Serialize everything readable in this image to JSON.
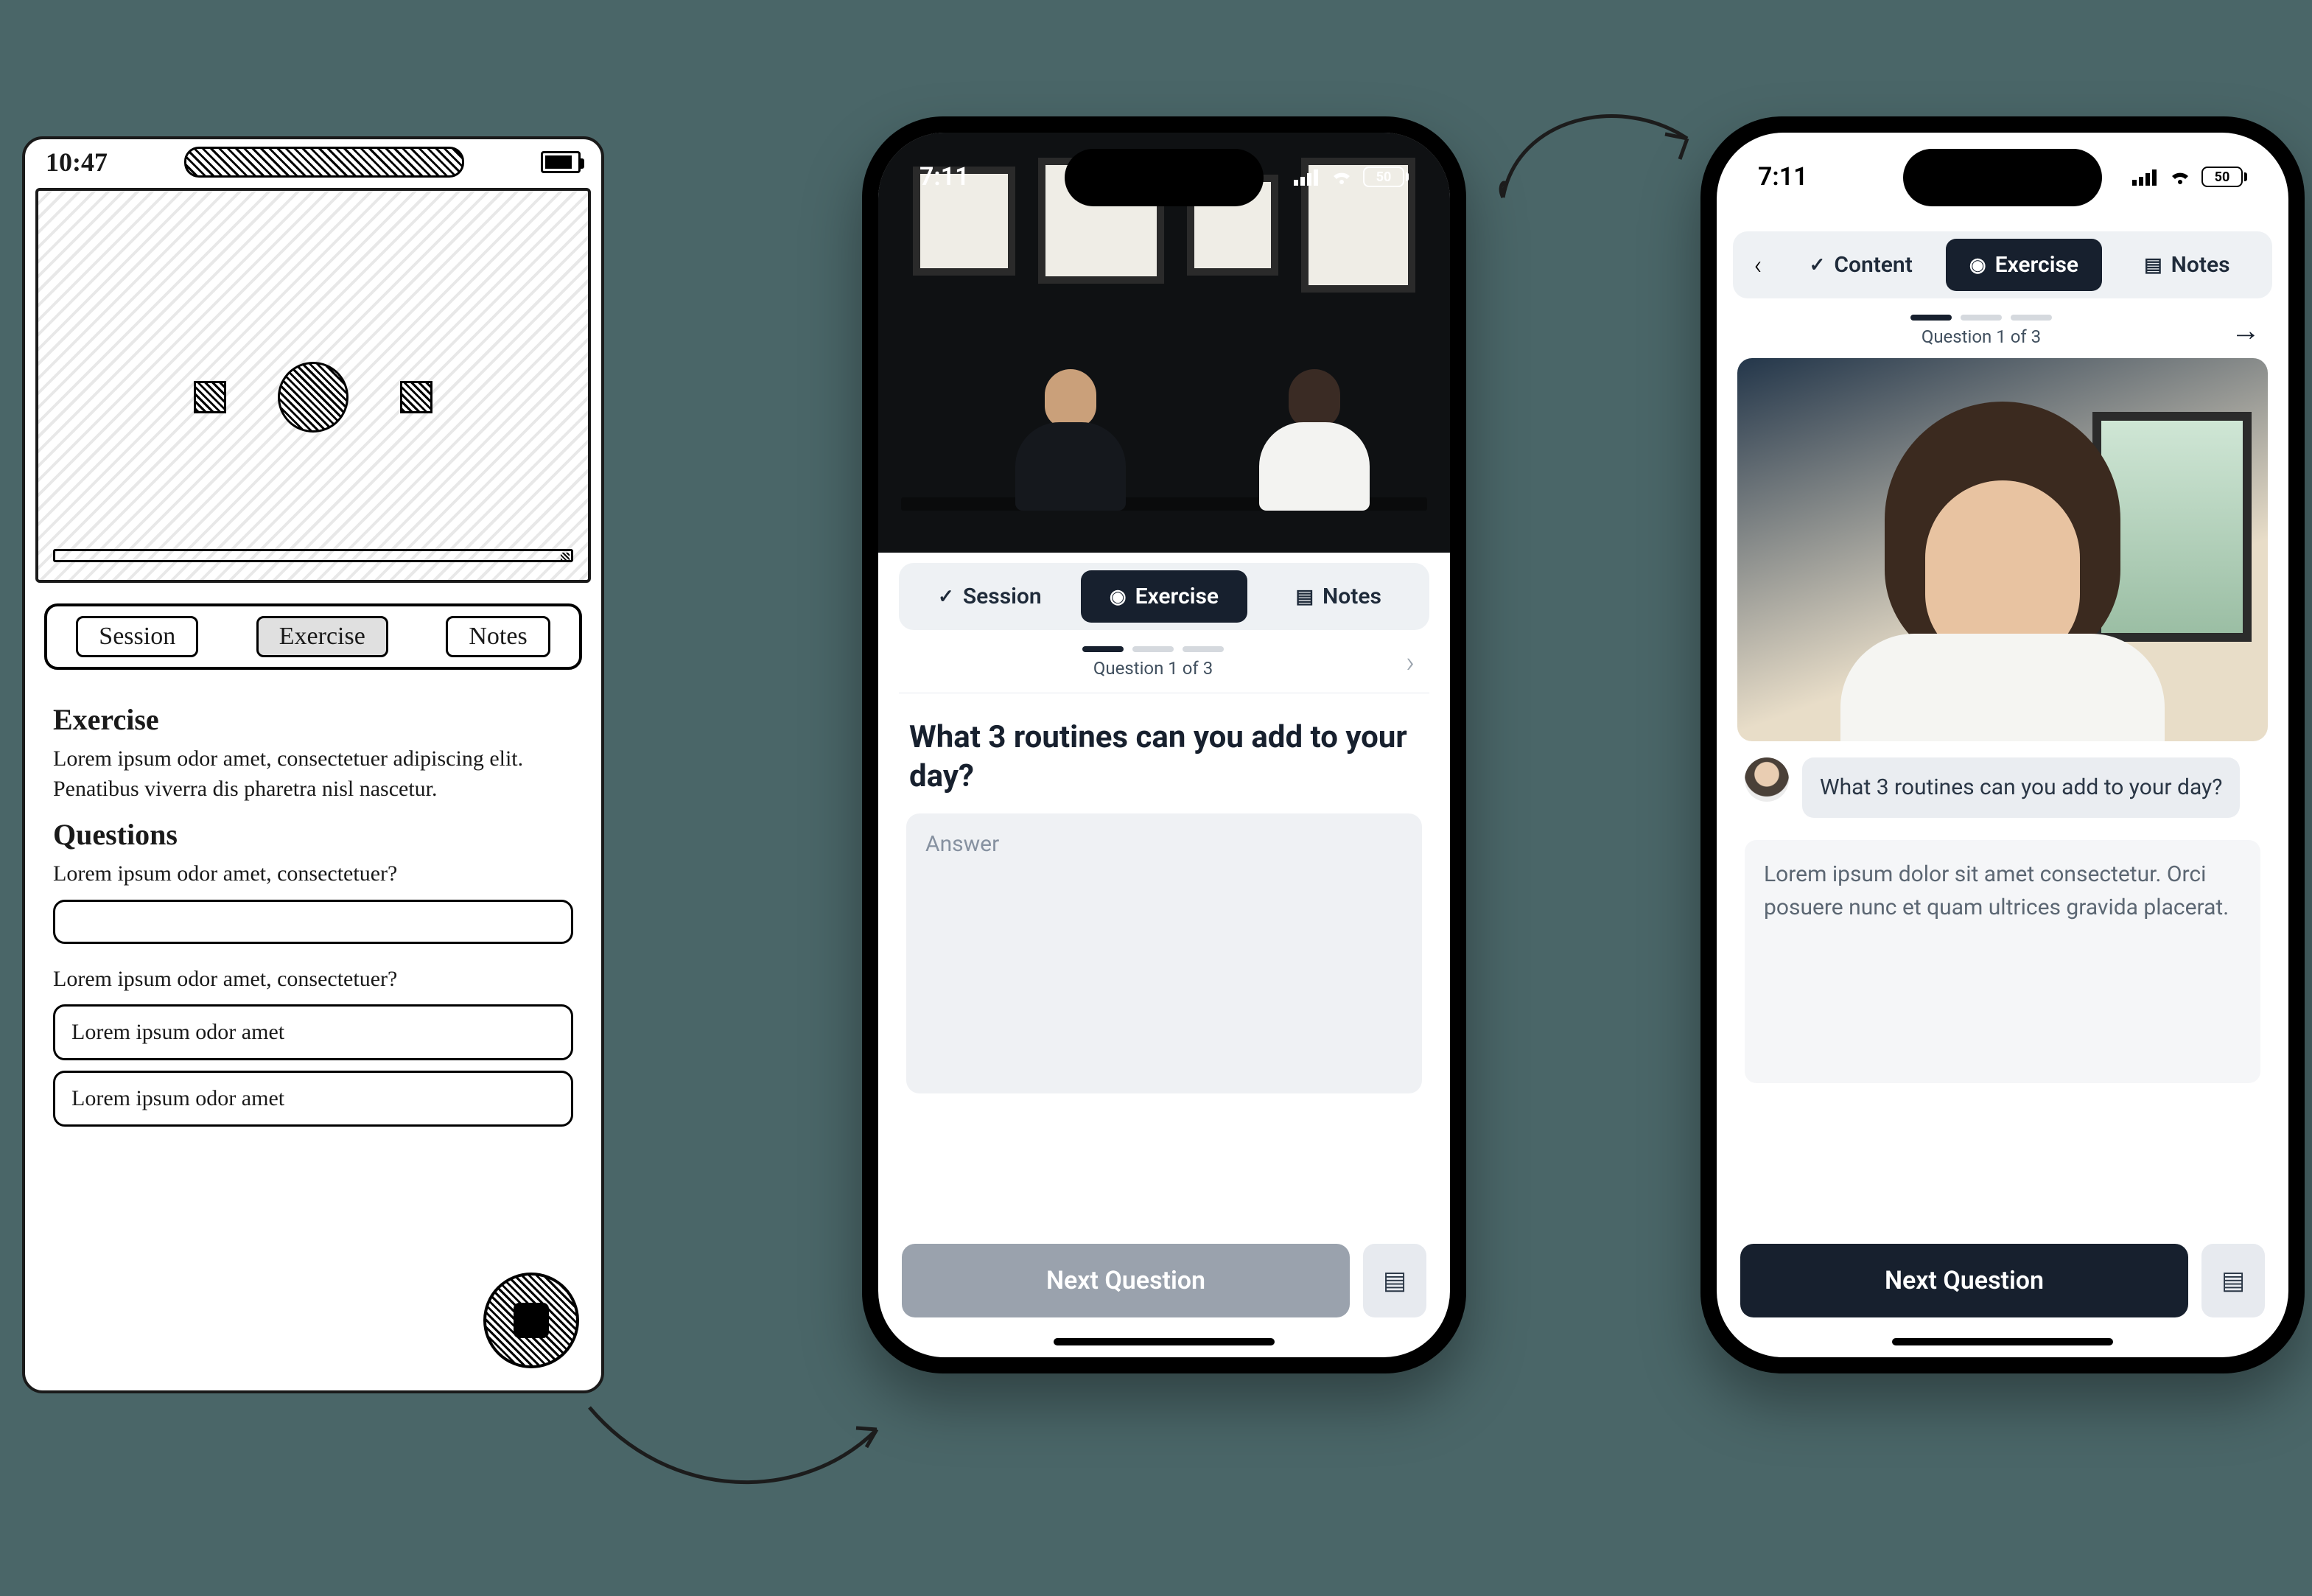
{
  "sketch": {
    "time": "10:47",
    "tabs": {
      "session": "Session",
      "exercise": "Exercise",
      "notes": "Notes"
    },
    "h1": "Exercise",
    "desc": "Lorem ipsum odor amet, consectetuer adipiscing elit. Penatibus viverra dis pharetra nisl nascetur.",
    "h2": "Questions",
    "q1": "Lorem ipsum odor amet, consectetuer?",
    "q2": "Lorem ipsum odor amet, consectetuer?",
    "opt1": "Lorem ipsum odor amet",
    "opt2": "Lorem ipsum odor amet"
  },
  "mid": {
    "time": "7:11",
    "battery": "50",
    "tabs": {
      "session": "Session",
      "exercise": "Exercise",
      "notes": "Notes"
    },
    "progress_label": "Question 1 of 3",
    "question": "What 3 routines can you add to your day?",
    "answer_placeholder": "Answer",
    "next": "Next Question"
  },
  "right": {
    "time": "7:11",
    "battery": "50",
    "tabs": {
      "content": "Content",
      "exercise": "Exercise",
      "notes": "Notes"
    },
    "progress_label": "Question 1 of 3",
    "chat_question": "What 3 routines can you add to your day?",
    "reply": "Lorem ipsum dolor sit amet consectetur. Orci posuere nunc et quam ultrices gravida placerat.",
    "next": "Next Question"
  }
}
